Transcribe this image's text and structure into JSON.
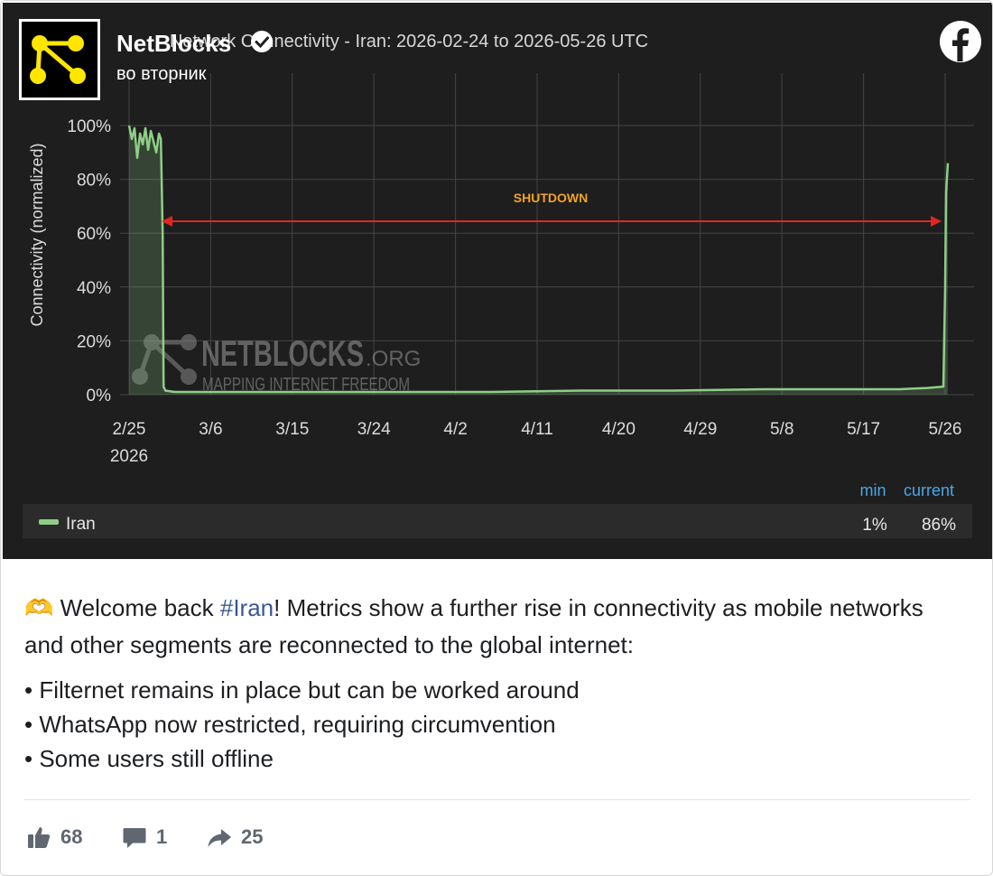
{
  "post": {
    "author": "NetBlocks",
    "time": "во вторник",
    "body_pre": "🫶 Welcome back ",
    "hashtag": "#Iran",
    "body_post": "! Metrics show a further rise in connectivity as mobile networks and other segments are reconnected to the global internet:",
    "bullets": [
      "• Filternet remains in place but can be worked around",
      "• WhatsApp now restricted, requiring circumvention",
      "• Some users still offline"
    ],
    "likes": "68",
    "comments": "1",
    "shares": "25"
  },
  "icons": {
    "avatar": "netblocks-logo",
    "verified": "verified-badge-icon",
    "platform": "facebook-icon",
    "like": "thumbs-up-icon",
    "comment": "comment-icon",
    "share": "share-icon"
  },
  "colors": {
    "chart_background": "#1e1e1e",
    "series_line": "#8fce87",
    "annotation_arrow": "#e2261f",
    "annotation_text": "#f0a326",
    "legend_header": "#4aa6e6",
    "hashtag": "#385898",
    "logo_yellow": "#ffe600"
  },
  "chart_data": {
    "type": "line",
    "title": "Network Connectivity - Iran: 2026-02-24 to 2026-05-26 UTC",
    "ylabel": "Connectivity (normalized)",
    "ylim": [
      0,
      100
    ],
    "y_ticks": [
      "0%",
      "20%",
      "40%",
      "60%",
      "80%",
      "100%"
    ],
    "x_ticks": [
      "2/25",
      "3/6",
      "3/15",
      "3/24",
      "4/2",
      "4/11",
      "4/20",
      "4/29",
      "5/8",
      "5/17",
      "5/26"
    ],
    "x_year_label": "2026",
    "watermark": {
      "brand": "NETBLOCKS",
      "suffix": ".ORG",
      "tagline": "MAPPING INTERNET FREEDOM"
    },
    "annotation": "SHUTDOWN",
    "series": [
      {
        "name": "Iran",
        "x": [
          0.0,
          0.3,
          0.6,
          0.9,
          1.2,
          1.5,
          1.8,
          2.1,
          2.4,
          2.7,
          3.0,
          3.3,
          3.5,
          3.7,
          3.8,
          4.0,
          5,
          10,
          20,
          30,
          40,
          50,
          60,
          70,
          80,
          85,
          88,
          89.8,
          90.0,
          90.1,
          90.3
        ],
        "y": [
          100,
          95,
          99,
          88,
          97,
          93,
          99,
          91,
          98,
          94,
          90,
          97,
          95,
          60,
          3,
          1.5,
          1,
          1,
          1,
          1,
          1,
          1.5,
          1.5,
          2,
          2,
          2,
          2.5,
          3,
          40,
          75,
          86
        ]
      }
    ],
    "legend": {
      "headers": [
        "min",
        "current"
      ],
      "rows": [
        {
          "name": "Iran",
          "min": "1%",
          "current": "86%"
        }
      ]
    }
  }
}
